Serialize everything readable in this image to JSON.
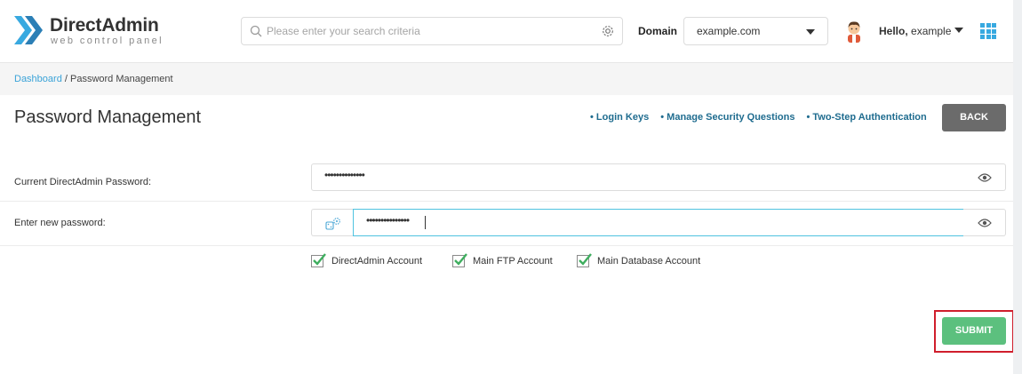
{
  "header": {
    "brand": "DirectAdmin",
    "tagline": "web control panel",
    "search_placeholder": "Please enter your search criteria",
    "domain_label": "Domain",
    "domain_value": "example.com",
    "greeting_prefix": "Hello,",
    "username": "example"
  },
  "breadcrumb": {
    "home": "Dashboard",
    "separator": " / ",
    "current": "Password Management"
  },
  "page": {
    "title": "Password Management",
    "links": [
      "• Login Keys",
      "• Manage Security Questions",
      "• Two-Step Authentication"
    ],
    "back_label": "BACK"
  },
  "form": {
    "current_label": "Current DirectAdmin Password:",
    "current_value": "••••••••••••••",
    "new_label": "Enter new password:",
    "new_value": "•••••••••••••••",
    "checkboxes": [
      {
        "label": "DirectAdmin Account",
        "checked": true
      },
      {
        "label": "Main FTP Account",
        "checked": true
      },
      {
        "label": "Main Database Account",
        "checked": true
      }
    ],
    "submit_label": "SUBMIT"
  },
  "colors": {
    "accent": "#38a9e0",
    "link": "#1f6c8f",
    "submit": "#5cc07e",
    "back": "#6b6b6b",
    "highlight": "#d01e2c",
    "check": "#3fae5f"
  },
  "icons": [
    "logo-icon",
    "search-icon",
    "settings-icon",
    "avatar",
    "apps-grid-icon",
    "eye-icon",
    "generate-password-icon",
    "checkmark-icon"
  ]
}
